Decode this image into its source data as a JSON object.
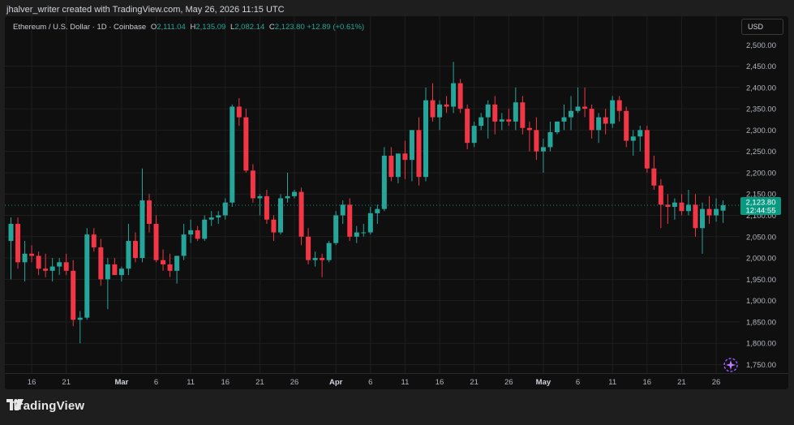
{
  "attribution": "jhalver_writer created with TradingView.com, May 26, 2026 11:15 UTC",
  "legend": {
    "symbol": "Ethereum / U.S. Dollar · 1D · Coinbase",
    "o_label": "O",
    "o": "2,111.04",
    "h_label": "H",
    "h": "2,135.09",
    "l_label": "L",
    "l": "2,082.14",
    "c_label": "C",
    "c": "2,123.80",
    "change": "+12.89 (+0.61%)"
  },
  "currency_button": "USD",
  "footer": {
    "brand": "TradingView"
  },
  "colors": {
    "up": "#26a69a",
    "down": "#f23645",
    "background": "#0f0f0f",
    "price_tag": "#089981"
  },
  "icons": [
    "tradingview-logo-icon",
    "sparkle-icon"
  ],
  "chart_data": {
    "type": "candlestick",
    "title": "Ethereum / U.S. Dollar",
    "xlabel": "",
    "ylabel": "",
    "ylim": [
      1730,
      2510
    ],
    "y_ticks": [
      1750,
      1800,
      1850,
      1900,
      1950,
      2000,
      2050,
      2100,
      2150,
      2200,
      2250,
      2300,
      2350,
      2400,
      2450
    ],
    "y_tick_labels": [
      "1,750.00",
      "1,800.00",
      "1,850.00",
      "1,900.00",
      "1,950.00",
      "2,000.00",
      "2,050.00",
      "2,100.00",
      "2,150.00",
      "2,200.00",
      "2,250.00",
      "2,300.00",
      "2,350.00",
      "2,400.00",
      "2,450.00",
      "2,500.00"
    ],
    "x_tick_labels": [
      {
        "label": "16",
        "index": 3
      },
      {
        "label": "21",
        "index": 8
      },
      {
        "label": "Mar",
        "index": 16
      },
      {
        "label": "6",
        "index": 21
      },
      {
        "label": "11",
        "index": 26
      },
      {
        "label": "16",
        "index": 31
      },
      {
        "label": "21",
        "index": 36
      },
      {
        "label": "26",
        "index": 41
      },
      {
        "label": "Apr",
        "index": 47
      },
      {
        "label": "6",
        "index": 52
      },
      {
        "label": "11",
        "index": 57
      },
      {
        "label": "16",
        "index": 62
      },
      {
        "label": "21",
        "index": 67
      },
      {
        "label": "26",
        "index": 72
      },
      {
        "label": "May",
        "index": 77
      },
      {
        "label": "6",
        "index": 82
      },
      {
        "label": "11",
        "index": 87
      },
      {
        "label": "16",
        "index": 92
      },
      {
        "label": "21",
        "index": 97
      },
      {
        "label": "26",
        "index": 102
      }
    ],
    "last_price": {
      "value": 2123.8,
      "label": "2,123.80",
      "countdown": "12:44:55"
    },
    "candles": [
      {
        "o": 2040,
        "h": 2095,
        "l": 1950,
        "c": 2080
      },
      {
        "o": 2080,
        "h": 2095,
        "l": 1975,
        "c": 1990
      },
      {
        "o": 1990,
        "h": 2040,
        "l": 1945,
        "c": 2010
      },
      {
        "o": 2010,
        "h": 2030,
        "l": 1990,
        "c": 2005
      },
      {
        "o": 2005,
        "h": 2015,
        "l": 1960,
        "c": 1975
      },
      {
        "o": 1975,
        "h": 2010,
        "l": 1955,
        "c": 1970
      },
      {
        "o": 1970,
        "h": 2000,
        "l": 1945,
        "c": 1980
      },
      {
        "o": 1980,
        "h": 2000,
        "l": 1960,
        "c": 1990
      },
      {
        "o": 1990,
        "h": 2010,
        "l": 1960,
        "c": 1970
      },
      {
        "o": 1970,
        "h": 1995,
        "l": 1840,
        "c": 1855
      },
      {
        "o": 1855,
        "h": 1875,
        "l": 1800,
        "c": 1860
      },
      {
        "o": 1860,
        "h": 2070,
        "l": 1855,
        "c": 2055
      },
      {
        "o": 2055,
        "h": 2070,
        "l": 2015,
        "c": 2025
      },
      {
        "o": 2025,
        "h": 2045,
        "l": 1935,
        "c": 1950
      },
      {
        "o": 1950,
        "h": 2000,
        "l": 1880,
        "c": 1985
      },
      {
        "o": 1985,
        "h": 2000,
        "l": 1960,
        "c": 1960
      },
      {
        "o": 1960,
        "h": 1980,
        "l": 1945,
        "c": 1975
      },
      {
        "o": 1975,
        "h": 2080,
        "l": 1960,
        "c": 2040
      },
      {
        "o": 2040,
        "h": 2060,
        "l": 1990,
        "c": 2000
      },
      {
        "o": 2000,
        "h": 2210,
        "l": 1990,
        "c": 2135
      },
      {
        "o": 2135,
        "h": 2150,
        "l": 2060,
        "c": 2080
      },
      {
        "o": 2080,
        "h": 2100,
        "l": 1990,
        "c": 1995
      },
      {
        "o": 1995,
        "h": 2020,
        "l": 1970,
        "c": 1985
      },
      {
        "o": 1985,
        "h": 2010,
        "l": 1955,
        "c": 1970
      },
      {
        "o": 1970,
        "h": 2000,
        "l": 1940,
        "c": 2005
      },
      {
        "o": 2005,
        "h": 2080,
        "l": 1995,
        "c": 2055
      },
      {
        "o": 2055,
        "h": 2090,
        "l": 2035,
        "c": 2065
      },
      {
        "o": 2065,
        "h": 2075,
        "l": 2040,
        "c": 2045
      },
      {
        "o": 2045,
        "h": 2100,
        "l": 2040,
        "c": 2090
      },
      {
        "o": 2090,
        "h": 2110,
        "l": 2075,
        "c": 2095
      },
      {
        "o": 2095,
        "h": 2110,
        "l": 2080,
        "c": 2100
      },
      {
        "o": 2100,
        "h": 2140,
        "l": 2090,
        "c": 2130
      },
      {
        "o": 2130,
        "h": 2360,
        "l": 2120,
        "c": 2355
      },
      {
        "o": 2355,
        "h": 2375,
        "l": 2310,
        "c": 2330
      },
      {
        "o": 2330,
        "h": 2350,
        "l": 2200,
        "c": 2205
      },
      {
        "o": 2205,
        "h": 2220,
        "l": 2130,
        "c": 2140
      },
      {
        "o": 2140,
        "h": 2150,
        "l": 2100,
        "c": 2145
      },
      {
        "o": 2145,
        "h": 2160,
        "l": 2080,
        "c": 2090
      },
      {
        "o": 2090,
        "h": 2100,
        "l": 2040,
        "c": 2060
      },
      {
        "o": 2060,
        "h": 2150,
        "l": 2055,
        "c": 2140
      },
      {
        "o": 2140,
        "h": 2200,
        "l": 2130,
        "c": 2145
      },
      {
        "o": 2145,
        "h": 2160,
        "l": 2140,
        "c": 2155
      },
      {
        "o": 2155,
        "h": 2165,
        "l": 2030,
        "c": 2050
      },
      {
        "o": 2050,
        "h": 2070,
        "l": 1985,
        "c": 1995
      },
      {
        "o": 1995,
        "h": 2015,
        "l": 1980,
        "c": 2000
      },
      {
        "o": 2000,
        "h": 2010,
        "l": 1955,
        "c": 1995
      },
      {
        "o": 1995,
        "h": 2040,
        "l": 1990,
        "c": 2035
      },
      {
        "o": 2035,
        "h": 2110,
        "l": 2030,
        "c": 2100
      },
      {
        "o": 2100,
        "h": 2135,
        "l": 2080,
        "c": 2125
      },
      {
        "o": 2125,
        "h": 2140,
        "l": 2040,
        "c": 2050
      },
      {
        "o": 2050,
        "h": 2075,
        "l": 2035,
        "c": 2060
      },
      {
        "o": 2060,
        "h": 2080,
        "l": 2050,
        "c": 2060
      },
      {
        "o": 2060,
        "h": 2120,
        "l": 2055,
        "c": 2105
      },
      {
        "o": 2105,
        "h": 2125,
        "l": 2080,
        "c": 2115
      },
      {
        "o": 2115,
        "h": 2260,
        "l": 2110,
        "c": 2240
      },
      {
        "o": 2240,
        "h": 2260,
        "l": 2180,
        "c": 2190
      },
      {
        "o": 2190,
        "h": 2220,
        "l": 2175,
        "c": 2245
      },
      {
        "o": 2245,
        "h": 2275,
        "l": 2185,
        "c": 2230
      },
      {
        "o": 2230,
        "h": 2300,
        "l": 2180,
        "c": 2300
      },
      {
        "o": 2300,
        "h": 2330,
        "l": 2170,
        "c": 2190
      },
      {
        "o": 2190,
        "h": 2400,
        "l": 2180,
        "c": 2370
      },
      {
        "o": 2370,
        "h": 2410,
        "l": 2320,
        "c": 2330
      },
      {
        "o": 2330,
        "h": 2370,
        "l": 2300,
        "c": 2360
      },
      {
        "o": 2360,
        "h": 2380,
        "l": 2340,
        "c": 2355
      },
      {
        "o": 2355,
        "h": 2460,
        "l": 2340,
        "c": 2410
      },
      {
        "o": 2410,
        "h": 2420,
        "l": 2340,
        "c": 2350
      },
      {
        "o": 2350,
        "h": 2360,
        "l": 2255,
        "c": 2270
      },
      {
        "o": 2270,
        "h": 2320,
        "l": 2260,
        "c": 2310
      },
      {
        "o": 2310,
        "h": 2340,
        "l": 2300,
        "c": 2330
      },
      {
        "o": 2330,
        "h": 2370,
        "l": 2280,
        "c": 2360
      },
      {
        "o": 2360,
        "h": 2380,
        "l": 2290,
        "c": 2320
      },
      {
        "o": 2320,
        "h": 2340,
        "l": 2300,
        "c": 2325
      },
      {
        "o": 2325,
        "h": 2350,
        "l": 2310,
        "c": 2320
      },
      {
        "o": 2320,
        "h": 2400,
        "l": 2300,
        "c": 2365
      },
      {
        "o": 2365,
        "h": 2380,
        "l": 2290,
        "c": 2305
      },
      {
        "o": 2305,
        "h": 2320,
        "l": 2250,
        "c": 2300
      },
      {
        "o": 2300,
        "h": 2330,
        "l": 2230,
        "c": 2250
      },
      {
        "o": 2250,
        "h": 2280,
        "l": 2200,
        "c": 2260
      },
      {
        "o": 2260,
        "h": 2320,
        "l": 2250,
        "c": 2295
      },
      {
        "o": 2295,
        "h": 2320,
        "l": 2290,
        "c": 2320
      },
      {
        "o": 2320,
        "h": 2360,
        "l": 2300,
        "c": 2330
      },
      {
        "o": 2330,
        "h": 2380,
        "l": 2300,
        "c": 2345
      },
      {
        "o": 2345,
        "h": 2400,
        "l": 2340,
        "c": 2355
      },
      {
        "o": 2355,
        "h": 2400,
        "l": 2330,
        "c": 2350
      },
      {
        "o": 2350,
        "h": 2360,
        "l": 2280,
        "c": 2300
      },
      {
        "o": 2300,
        "h": 2340,
        "l": 2270,
        "c": 2330
      },
      {
        "o": 2330,
        "h": 2350,
        "l": 2290,
        "c": 2315
      },
      {
        "o": 2315,
        "h": 2380,
        "l": 2305,
        "c": 2370
      },
      {
        "o": 2370,
        "h": 2380,
        "l": 2320,
        "c": 2345
      },
      {
        "o": 2345,
        "h": 2355,
        "l": 2260,
        "c": 2275
      },
      {
        "o": 2275,
        "h": 2300,
        "l": 2240,
        "c": 2285
      },
      {
        "o": 2285,
        "h": 2310,
        "l": 2250,
        "c": 2300
      },
      {
        "o": 2300,
        "h": 2310,
        "l": 2200,
        "c": 2210
      },
      {
        "o": 2210,
        "h": 2240,
        "l": 2160,
        "c": 2170
      },
      {
        "o": 2170,
        "h": 2185,
        "l": 2070,
        "c": 2125
      },
      {
        "o": 2125,
        "h": 2150,
        "l": 2080,
        "c": 2120
      },
      {
        "o": 2120,
        "h": 2140,
        "l": 2090,
        "c": 2130
      },
      {
        "o": 2130,
        "h": 2150,
        "l": 2100,
        "c": 2110
      },
      {
        "o": 2110,
        "h": 2160,
        "l": 2100,
        "c": 2125
      },
      {
        "o": 2125,
        "h": 2150,
        "l": 2050,
        "c": 2070
      },
      {
        "o": 2070,
        "h": 2130,
        "l": 2010,
        "c": 2115
      },
      {
        "o": 2115,
        "h": 2145,
        "l": 2080,
        "c": 2100
      },
      {
        "o": 2100,
        "h": 2140,
        "l": 2085,
        "c": 2115
      },
      {
        "o": 2111.04,
        "h": 2135.09,
        "l": 2082.14,
        "c": 2123.8
      }
    ]
  }
}
